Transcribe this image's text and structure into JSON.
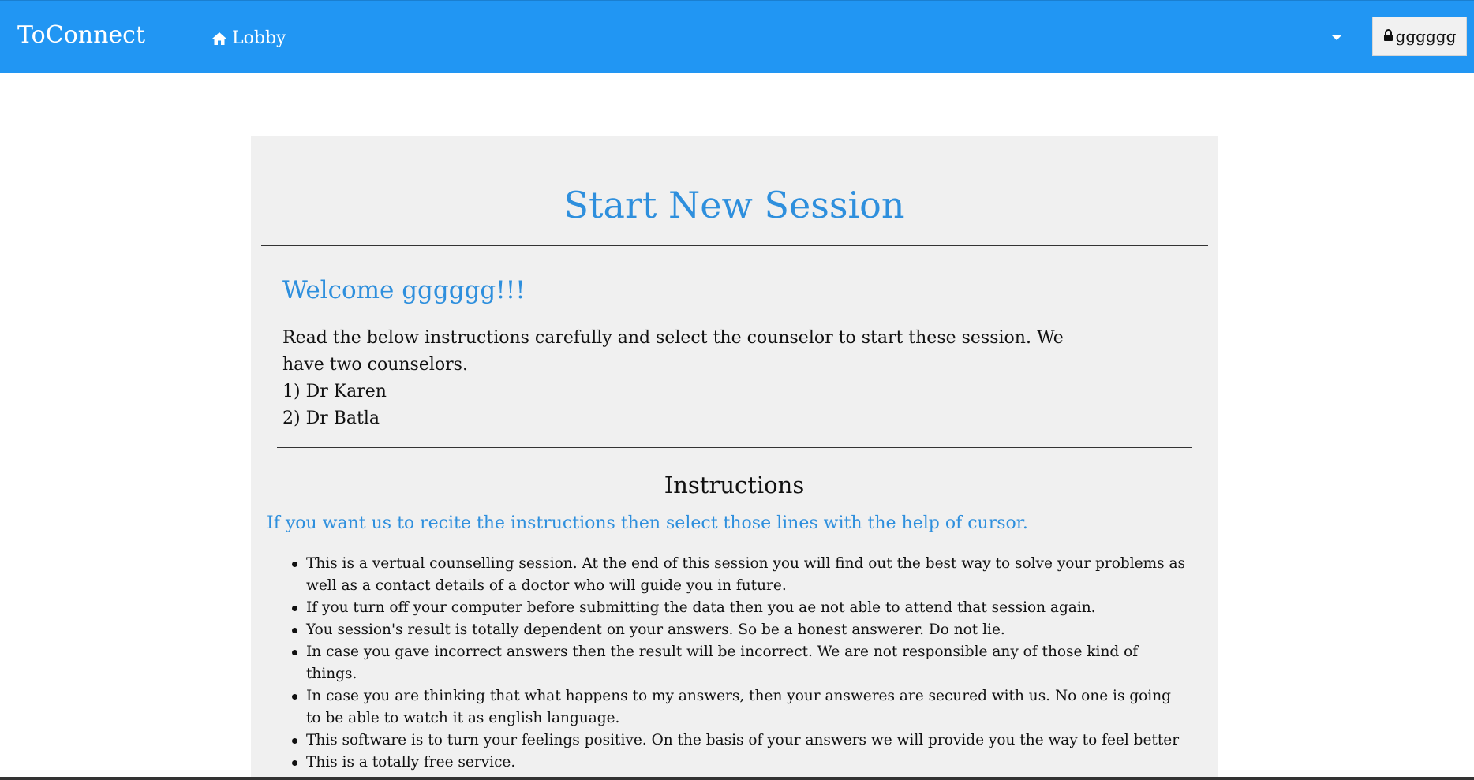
{
  "navbar": {
    "brand": "ToConnect",
    "lobby_label": "Lobby",
    "lobby_icon": "home-icon",
    "dropdown_icon": "caret-down-icon",
    "user_label": "gggggg",
    "user_icon": "lock-icon",
    "bg_color": "#2196f3"
  },
  "main": {
    "title": "Start New Session",
    "welcome": "Welcome gggggg!!!",
    "intro_lines": [
      "Read the below instructions carefully and select the counselor to start these session. We have two counselors.",
      "1) Dr Karen",
      "2) Dr Batla"
    ],
    "instructions_heading": "Instructions",
    "recite_note": "If you want us to recite the instructions then select those lines with the help of cursor.",
    "instructions": [
      "This is a vertual counselling session. At the end of this session you will find out the best way to solve your problems as well as a contact details of a doctor who will guide you in future.",
      "If you turn off your computer before submitting the data then you ae not able to attend that session again.",
      "You session's result is totally dependent on your answers. So be a honest answerer. Do not lie.",
      "In case you gave incorrect answers then the result will be incorrect. We are not responsible any of those kind of things.",
      "In case you are thinking that what happens to my answers, then your answeres are secured with us. No one is going to be able to watch it as english language.",
      "This software is to turn your feelings positive. On the basis of your answers we will provide you the way to feel better",
      "This is a totally free service."
    ],
    "accent_color": "#2e8fdd"
  }
}
